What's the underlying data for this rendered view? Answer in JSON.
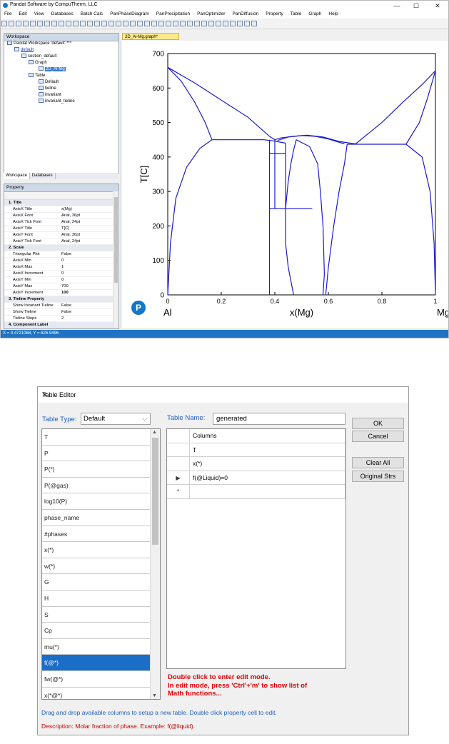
{
  "app": {
    "title": "Pandat Software by CompuTherm, LLC",
    "window_buttons": [
      "—",
      "☐",
      "✕"
    ],
    "menu": [
      "File",
      "Edit",
      "View",
      "Databases",
      "Batch Calc",
      "PanPhaseDiagram",
      "PanPrecipitation",
      "PanOptimizer",
      "PanDiffusion",
      "Property",
      "Table",
      "Graph",
      "Help"
    ],
    "workspace": {
      "header": "Workspace",
      "tree": [
        "Pandat Workspace 'default' ***",
        "default",
        "section_default",
        "Graph",
        "2D_Al-Mg",
        "Table",
        "Default",
        "tieline",
        "invariant",
        "invariant_tieline"
      ],
      "tabs": [
        "Workspace",
        "Databases"
      ]
    },
    "property": {
      "header": "Property",
      "rows": [
        {
          "k": "1. Title",
          "v": "",
          "cat": true
        },
        {
          "k": "AxisX Title",
          "v": "x(Mg)"
        },
        {
          "k": "AxisX Font",
          "v": "Arial, 36pt"
        },
        {
          "k": "AxisX Tick Font",
          "v": "Arial, 24pt"
        },
        {
          "k": "AxisY Title",
          "v": "T[C]"
        },
        {
          "k": "AxisY Font",
          "v": "Arial, 36pt"
        },
        {
          "k": "AxisY Tick Font",
          "v": "Arial, 24pt"
        },
        {
          "k": "2. Scale",
          "v": "",
          "cat": true
        },
        {
          "k": "Triangular Plot",
          "v": "False"
        },
        {
          "k": "AxisX Min",
          "v": "0"
        },
        {
          "k": "AxisX Max",
          "v": "1"
        },
        {
          "k": "AxisX Increment",
          "v": "0"
        },
        {
          "k": "AxisY Min",
          "v": "0"
        },
        {
          "k": "AxisY Max",
          "v": "700"
        },
        {
          "k": "AxisY Increment",
          "v": "100"
        },
        {
          "k": "3. Tieline Property",
          "v": "",
          "cat": true
        },
        {
          "k": "Show Invariant Tieline",
          "v": "False"
        },
        {
          "k": "Show Tieline",
          "v": "False"
        },
        {
          "k": "Tieline Steps",
          "v": "2"
        },
        {
          "k": "4. Component Label",
          "v": "",
          "cat": true
        }
      ]
    },
    "doc_tab": "2D_Al-Mg.graph*",
    "status": "X = 0.4721088, Y = 626.9496"
  },
  "chart_data": {
    "type": "line",
    "title": "",
    "xlabel": "x(Mg)",
    "ylabel": "T[C]",
    "xlim": [
      0,
      1
    ],
    "ylim": [
      0,
      700
    ],
    "x_ticks": [
      "0",
      "0.2",
      "0.4",
      "0.6",
      "0.8",
      "1"
    ],
    "y_ticks": [
      "0",
      "100",
      "200",
      "300",
      "400",
      "500",
      "600",
      "700"
    ],
    "left_component": "Al",
    "right_component": "Mg",
    "line_color": "#1a1ad0",
    "series": [
      {
        "points": [
          [
            0,
            660
          ],
          [
            0.05,
            620
          ],
          [
            0.1,
            560
          ],
          [
            0.14,
            500
          ],
          [
            0.165,
            450
          ]
        ]
      },
      {
        "points": [
          [
            0,
            660
          ],
          [
            0.1,
            615
          ],
          [
            0.2,
            565
          ],
          [
            0.3,
            515
          ],
          [
            0.38,
            460
          ],
          [
            0.4,
            450
          ]
        ]
      },
      {
        "points": [
          [
            0,
            0
          ],
          [
            0.01,
            150
          ],
          [
            0.03,
            280
          ],
          [
            0.07,
            370
          ],
          [
            0.12,
            425
          ],
          [
            0.165,
            450
          ]
        ]
      },
      {
        "points": [
          [
            0.165,
            450
          ],
          [
            0.36,
            450
          ]
        ]
      },
      {
        "points": [
          [
            0.36,
            450
          ],
          [
            0.4,
            446
          ],
          [
            0.44,
            440
          ]
        ]
      },
      {
        "points": [
          [
            0.38,
            450
          ],
          [
            0.38,
            0
          ]
        ]
      },
      {
        "points": [
          [
            0.4,
            450
          ],
          [
            0.4,
            250
          ]
        ]
      },
      {
        "points": [
          [
            0.38,
            410
          ],
          [
            0.44,
            410
          ]
        ]
      },
      {
        "points": [
          [
            0.44,
            440
          ],
          [
            0.44,
            410
          ]
        ]
      },
      {
        "points": [
          [
            0.44,
            410
          ],
          [
            0.44,
            250
          ]
        ]
      },
      {
        "points": [
          [
            0.38,
            250
          ],
          [
            0.54,
            250
          ]
        ]
      },
      {
        "points": [
          [
            0.41,
            448
          ],
          [
            0.45,
            458
          ],
          [
            0.5,
            462
          ],
          [
            0.55,
            460
          ],
          [
            0.6,
            452
          ],
          [
            0.66,
            438
          ]
        ]
      },
      {
        "points": [
          [
            0.4,
            450
          ],
          [
            0.42,
            455
          ],
          [
            0.47,
            460
          ],
          [
            0.52,
            463
          ],
          [
            0.58,
            458
          ],
          [
            0.64,
            445
          ],
          [
            0.7,
            438
          ]
        ]
      },
      {
        "points": [
          [
            0.48,
            450
          ],
          [
            0.47,
            420
          ],
          [
            0.46,
            380
          ],
          [
            0.45,
            330
          ],
          [
            0.44,
            250
          ],
          [
            0.44,
            150
          ],
          [
            0.45,
            80
          ],
          [
            0.47,
            0
          ]
        ]
      },
      {
        "points": [
          [
            0.48,
            450
          ],
          [
            0.53,
            430
          ],
          [
            0.56,
            380
          ],
          [
            0.57,
            300
          ],
          [
            0.58,
            200
          ],
          [
            0.585,
            60
          ],
          [
            0.58,
            0
          ]
        ]
      },
      {
        "points": [
          [
            0.59,
            0
          ],
          [
            0.6,
            80
          ],
          [
            0.62,
            200
          ],
          [
            0.64,
            300
          ],
          [
            0.66,
            380
          ],
          [
            0.67,
            437
          ]
        ]
      },
      {
        "points": [
          [
            0.67,
            437
          ],
          [
            0.89,
            437
          ]
        ]
      },
      {
        "points": [
          [
            0.7,
            437
          ],
          [
            0.8,
            500
          ],
          [
            0.88,
            560
          ],
          [
            0.95,
            610
          ],
          [
            1.0,
            650
          ]
        ]
      },
      {
        "points": [
          [
            0.89,
            437
          ],
          [
            0.94,
            500
          ],
          [
            0.97,
            570
          ],
          [
            1.0,
            650
          ]
        ]
      },
      {
        "points": [
          [
            0.89,
            437
          ],
          [
            0.95,
            400
          ],
          [
            0.98,
            300
          ],
          [
            0.995,
            150
          ],
          [
            1.0,
            0
          ]
        ]
      }
    ]
  },
  "dialog": {
    "title": "Table Editor",
    "table_type_label": "Table Type:",
    "table_type_value": "Default",
    "table_name_label": "Table Name:",
    "table_name_value": "generated",
    "available_columns": [
      "T",
      "P",
      "P(*)",
      "P(@gas)",
      "log10(P)",
      "phase_name",
      "#phases",
      "x(*)",
      "w(*)",
      "G",
      "H",
      "S",
      "Cp",
      "mu(*)",
      "f(@*)",
      "fw(@*)",
      "x(*@*)"
    ],
    "selected_column_index": 14,
    "columns_header": "Columns",
    "columns": [
      "T",
      "x(*)",
      "f(@Liquid)=0"
    ],
    "row_markers": [
      "",
      "",
      "▶",
      "*"
    ],
    "buttons": {
      "ok": "OK",
      "cancel": "Cancel",
      "clear_all": "Clear All",
      "original_strs": "Original Strs"
    },
    "edit_hint_lines": [
      "Double click to enter edit mode.",
      "In edit mode, press 'Ctrl'+'m' to show list of",
      "Math functions..."
    ],
    "drag_hint": "Drag and drop available columns to setup a new table. Double click property cell to edit.",
    "description": "Description: Molar fraction of phase. Example: f(@liquid).",
    "close_glyph": "✕",
    "combo_arrow": "⌵"
  }
}
